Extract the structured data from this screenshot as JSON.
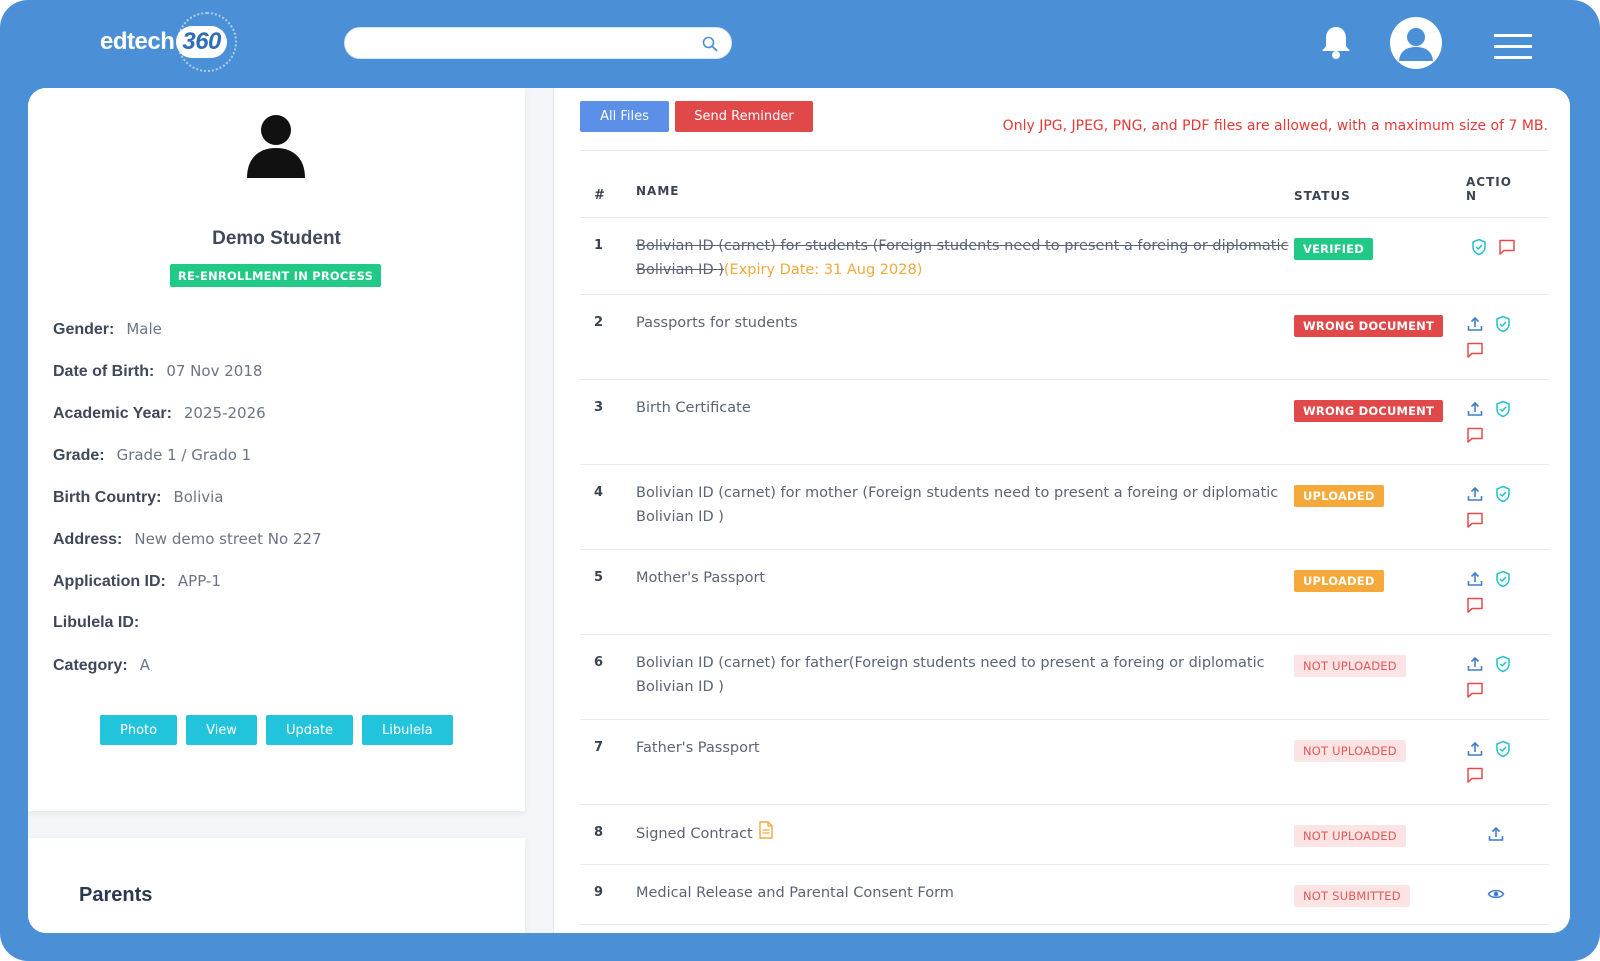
{
  "header": {
    "logo_text": "edtech",
    "logo_number": "360",
    "search_placeholder": ""
  },
  "student": {
    "name": "Demo Student",
    "status": "RE-ENROLLMENT IN PROCESS",
    "fields": [
      {
        "label": "Gender:",
        "value": "Male"
      },
      {
        "label": "Date of Birth:",
        "value": "07 Nov 2018"
      },
      {
        "label": "Academic Year:",
        "value": "2025-2026"
      },
      {
        "label": "Grade:",
        "value": "Grade 1 / Grado 1"
      },
      {
        "label": "Birth Country:",
        "value": "Bolivia"
      },
      {
        "label": "Address:",
        "value": "New demo street No 227"
      },
      {
        "label": "Application ID:",
        "value": "APP-1"
      },
      {
        "label": "Libulela ID:",
        "value": ""
      },
      {
        "label": "Category:",
        "value": "A"
      }
    ],
    "buttons": {
      "photo": "Photo",
      "view": "View",
      "update": "Update",
      "libulela": "Libulela"
    }
  },
  "parents": {
    "title": "Parents"
  },
  "docs": {
    "all_files": "All Files",
    "send_reminder": "Send Reminder",
    "notice": "Only JPG, JPEG, PNG, and PDF files are allowed, with a maximum size of 7 MB.",
    "columns": {
      "num": "#",
      "name": "NAME",
      "status": "STATUS",
      "action_1": "ACTIO",
      "action_2": "N"
    },
    "rows": [
      {
        "num": "1",
        "name": "Bolivian ID (carnet) for students (Foreign students need to present a foreing or diplomatic Bolivian ID )",
        "expiry": "(Expiry Date: 31 Aug 2028)",
        "status": "VERIFIED"
      },
      {
        "num": "2",
        "name": "Passports for students",
        "status": "WRONG DOCUMENT"
      },
      {
        "num": "3",
        "name": "Birth Certificate",
        "status": "WRONG DOCUMENT"
      },
      {
        "num": "4",
        "name": "Bolivian ID (carnet) for mother (Foreign students need to present a foreing or diplomatic Bolivian ID )",
        "status": "UPLOADED"
      },
      {
        "num": "5",
        "name": "Mother's Passport",
        "status": "UPLOADED"
      },
      {
        "num": "6",
        "name": "Bolivian ID (carnet) for father(Foreign students need to present a foreing or diplomatic Bolivian ID )",
        "status": "NOT UPLOADED"
      },
      {
        "num": "7",
        "name": "Father's Passport",
        "status": "NOT UPLOADED"
      },
      {
        "num": "8",
        "name": "Signed Contract",
        "status": "NOT UPLOADED"
      },
      {
        "num": "9",
        "name": "Medical Release and Parental Consent Form",
        "status": "NOT SUBMITTED"
      }
    ]
  },
  "colors": {
    "frame": "#4b8fd6",
    "verified": "#20c985",
    "wrong": "#e0484a",
    "uploaded": "#f4a93a",
    "not_uploaded_bg": "#fde4e4",
    "notice": "#e53935",
    "cyan_button": "#22c4dc"
  }
}
